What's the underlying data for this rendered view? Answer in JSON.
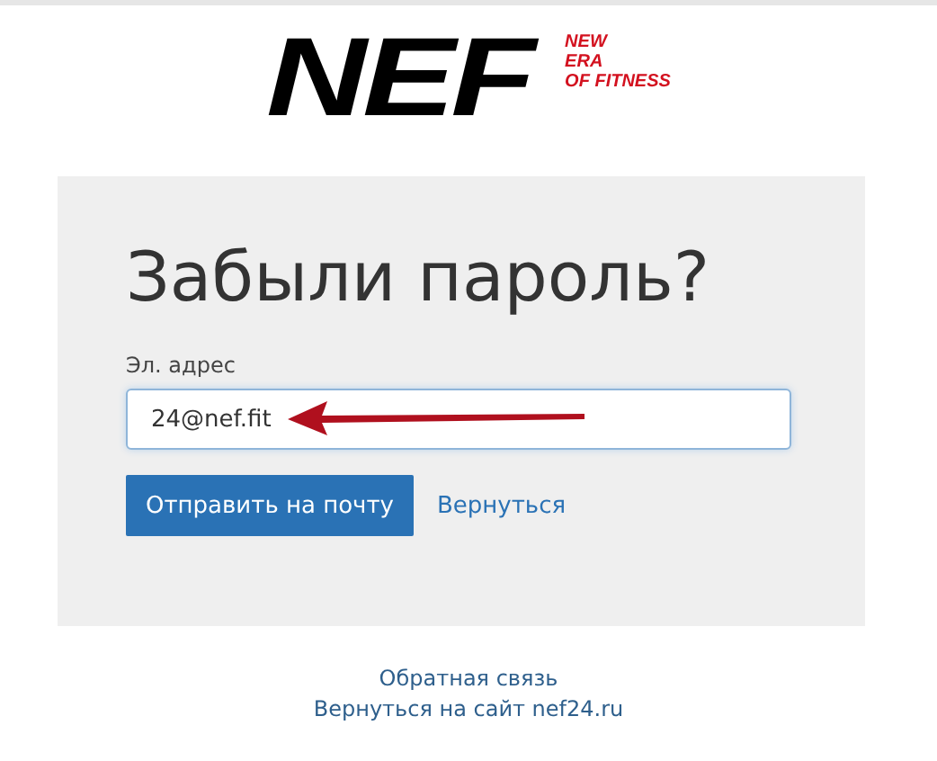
{
  "logo": {
    "mark": "NEF",
    "tagline": [
      "NEW",
      "ERA",
      "OF FITNESS"
    ]
  },
  "form": {
    "title": "Забыли пароль?",
    "email_label": "Эл. адрес",
    "email_value": "24@nef.fit",
    "submit": "Отправить на почту",
    "back": "Вернуться"
  },
  "footer": {
    "links": [
      "Обратная связь",
      "Вернуться на сайт nef24.ru"
    ]
  }
}
